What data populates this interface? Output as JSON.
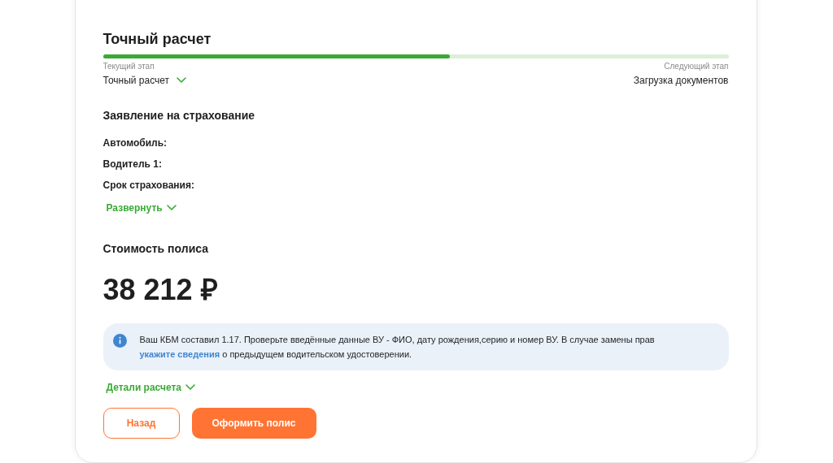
{
  "title": "Точный расчет",
  "progress": {
    "level": 0.555,
    "current_label": "Текущий этап",
    "current_value": "Точный расчет",
    "next_label": "Следующий этап",
    "next_value": "Загрузка документов"
  },
  "application": {
    "heading": "Заявление на страхование",
    "fields": [
      "Автомобиль:",
      "Водитель 1:",
      "Срок страхования:"
    ],
    "expand_link": "Развернуть"
  },
  "price": {
    "heading": "Стоимость полиса",
    "amount": "38 212 ₽"
  },
  "notice": {
    "text_before": "Ваш КБМ составил 1.17. Проверьте введённые данные ВУ - ФИО, дату рождения,серию и номер ВУ. В случае замены прав",
    "link": "укажите сведения",
    "text_after": "о предыдущем водительском удостоверении."
  },
  "details_link": "Детали расчета",
  "buttons": [
    {
      "label": "Назад",
      "kind": "secondary"
    },
    {
      "label": "Оформить полис",
      "kind": "primary"
    }
  ]
}
